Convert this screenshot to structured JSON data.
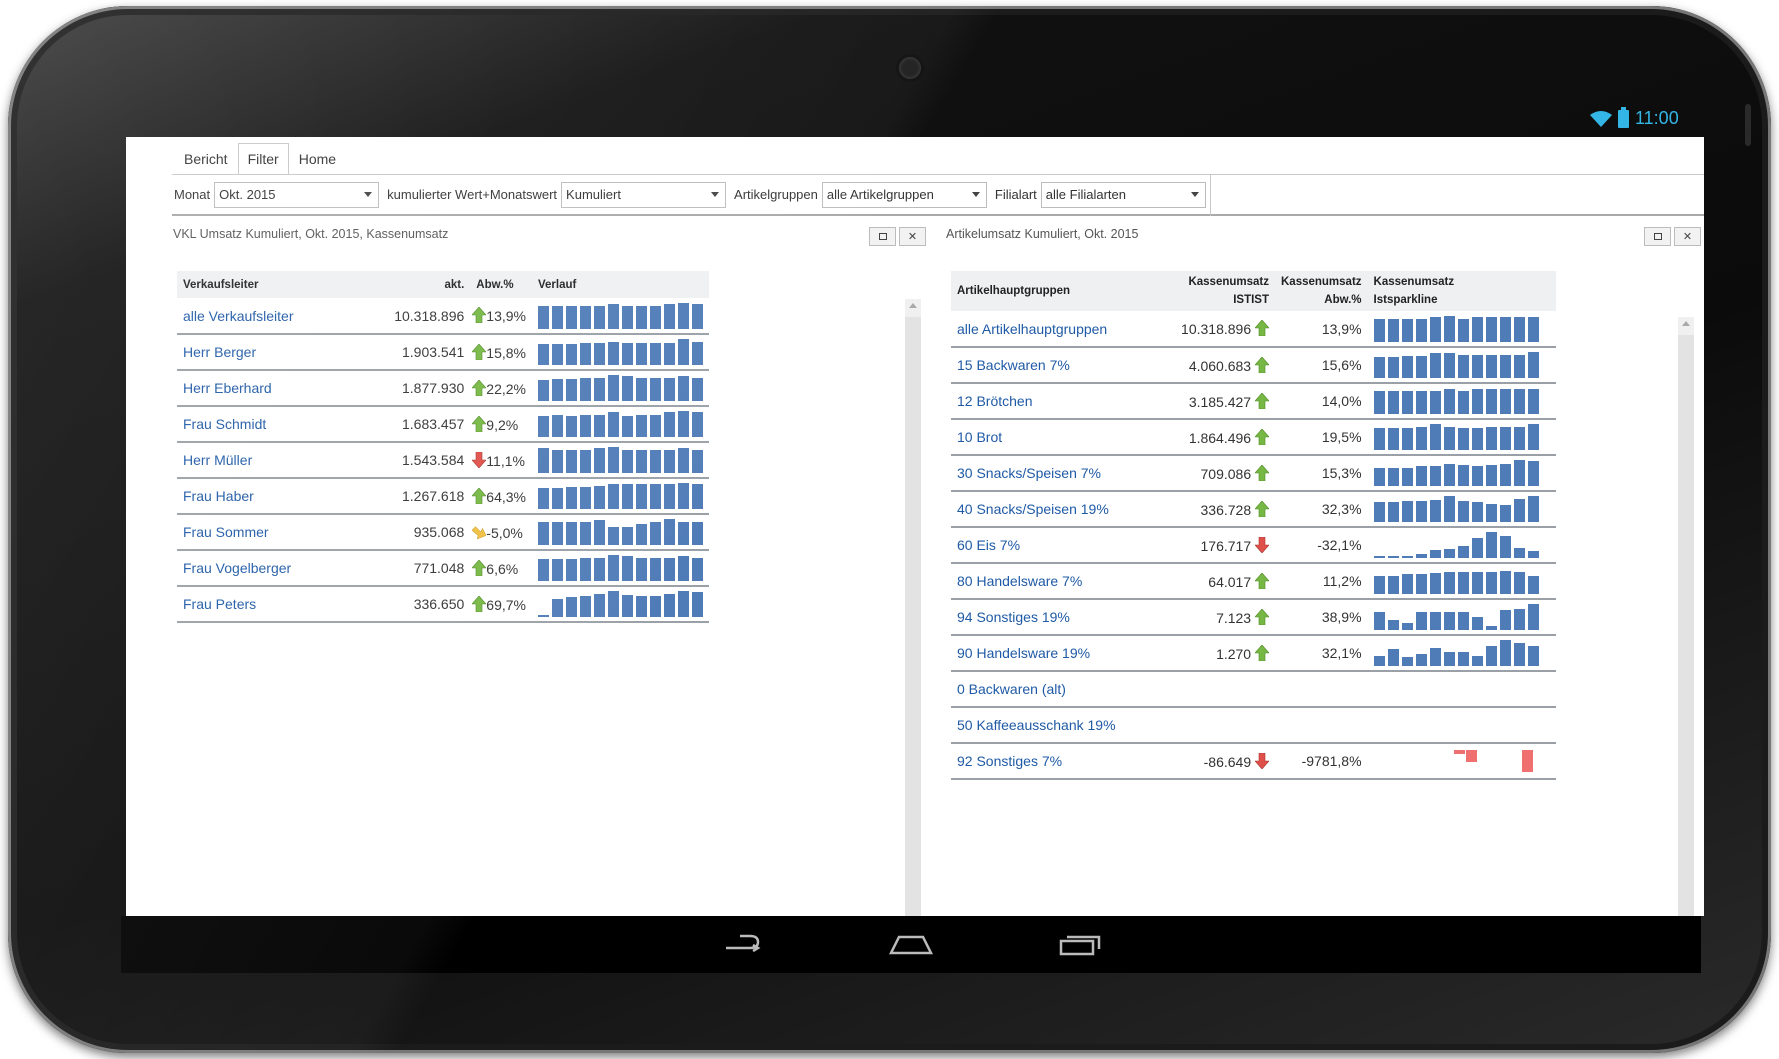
{
  "status": {
    "time": "11:00"
  },
  "tabs": [
    {
      "label": "Bericht"
    },
    {
      "label": "Filter"
    },
    {
      "label": "Home"
    }
  ],
  "filters": {
    "monat_label": "Monat",
    "monat_value": "Okt. 2015",
    "wert_label": "kumulierter Wert+Monatswert",
    "wert_value": "Kumuliert",
    "artikel_label": "Artikelgruppen",
    "artikel_value": "alle Artikelgruppen",
    "filialart_label": "Filialart",
    "filialart_value": "alle Filialarten"
  },
  "left_panel": {
    "title": "VKL Umsatz Kumuliert, Okt. 2015, Kassenumsatz",
    "headers": {
      "name": "Verkaufsleiter",
      "akt": "akt.",
      "abw": "Abw.%",
      "verlauf": "Verlauf"
    },
    "rows": [
      {
        "name": "alle Verkaufsleiter",
        "akt": "10.318.896",
        "trend": "up",
        "abw": "13,9%",
        "spark": [
          0.9,
          0.9,
          0.9,
          0.9,
          0.9,
          0.95,
          0.9,
          0.9,
          0.9,
          0.95,
          1,
          0.95
        ]
      },
      {
        "name": "Herr Berger",
        "akt": "1.903.541",
        "trend": "up",
        "abw": "15,8%",
        "spark": [
          0.8,
          0.8,
          0.8,
          0.85,
          0.85,
          0.9,
          0.85,
          0.85,
          0.85,
          0.85,
          1,
          0.9
        ]
      },
      {
        "name": "Herr Eberhard",
        "akt": "1.877.930",
        "trend": "up",
        "abw": "22,2%",
        "spark": [
          0.8,
          0.85,
          0.85,
          0.9,
          0.9,
          1,
          0.95,
          0.9,
          0.9,
          0.9,
          0.95,
          0.9
        ]
      },
      {
        "name": "Frau Schmidt",
        "akt": "1.683.457",
        "trend": "up",
        "abw": "9,2%",
        "spark": [
          0.8,
          0.85,
          0.8,
          0.85,
          0.85,
          0.95,
          0.8,
          0.85,
          0.85,
          0.95,
          1,
          0.95
        ]
      },
      {
        "name": "Herr Müller",
        "akt": "1.543.584",
        "trend": "down",
        "abw": "11,1%",
        "spark": [
          0.95,
          0.9,
          0.9,
          0.9,
          0.95,
          1,
          0.9,
          0.9,
          0.9,
          0.9,
          0.95,
          0.9
        ]
      },
      {
        "name": "Frau Haber",
        "akt": "1.267.618",
        "trend": "up",
        "abw": "64,3%",
        "spark": [
          0.8,
          0.8,
          0.85,
          0.85,
          0.9,
          0.95,
          0.95,
          0.95,
          0.95,
          0.95,
          1,
          0.95
        ]
      },
      {
        "name": "Frau Sommer",
        "akt": "935.068",
        "trend": "side",
        "abw": "-5,0%",
        "spark": [
          0.9,
          0.9,
          0.9,
          0.9,
          0.95,
          0.7,
          0.7,
          0.8,
          0.9,
          1,
          0.9,
          0.9
        ]
      },
      {
        "name": "Frau Vogelberger",
        "akt": "771.048",
        "trend": "up",
        "abw": "6,6%",
        "spark": [
          0.85,
          0.85,
          0.85,
          0.9,
          0.9,
          1,
          0.95,
          0.9,
          0.9,
          0.9,
          0.95,
          0.9
        ]
      },
      {
        "name": "Frau Peters",
        "akt": "336.650",
        "trend": "up",
        "abw": "69,7%",
        "spark": [
          0.08,
          0.7,
          0.75,
          0.8,
          0.9,
          1,
          0.85,
          0.8,
          0.8,
          0.9,
          1,
          0.95
        ]
      }
    ]
  },
  "right_panel": {
    "title": "Artikelumsatz Kumuliert, Okt. 2015",
    "headers": {
      "name": "Artikelhauptgruppen",
      "ist_top": "Kassenumsatz",
      "ist_bottom": "ISTIST",
      "abw_top": "Kassenumsatz",
      "abw_bottom": "Abw.%",
      "spark_top": "Kassenumsatz",
      "spark_bottom": "Istsparkline"
    },
    "rows": [
      {
        "name": "alle Artikelhauptgruppen",
        "ist": "10.318.896",
        "trend": "up",
        "abw": "13,9%",
        "spark": [
          0.9,
          0.9,
          0.9,
          0.9,
          0.95,
          1,
          0.9,
          0.95,
          0.95,
          0.95,
          0.95,
          0.95
        ]
      },
      {
        "name": "15 Backwaren 7%",
        "ist": "4.060.683",
        "trend": "up",
        "abw": "15,6%",
        "spark": [
          0.8,
          0.8,
          0.85,
          0.85,
          0.95,
          0.95,
          0.9,
          0.9,
          0.9,
          0.9,
          0.9,
          1
        ]
      },
      {
        "name": "12 Brötchen",
        "ist": "3.185.427",
        "trend": "up",
        "abw": "14,0%",
        "spark": [
          0.9,
          0.9,
          0.9,
          0.9,
          0.9,
          0.95,
          0.9,
          0.95,
          0.95,
          0.95,
          0.95,
          0.95
        ]
      },
      {
        "name": "10 Brot",
        "ist": "1.864.496",
        "trend": "up",
        "abw": "19,5%",
        "spark": [
          0.85,
          0.85,
          0.85,
          0.9,
          1,
          0.9,
          0.85,
          0.85,
          0.9,
          0.9,
          0.9,
          1
        ]
      },
      {
        "name": "30 Snacks/Speisen 7%",
        "ist": "709.086",
        "trend": "up",
        "abw": "15,3%",
        "spark": [
          0.7,
          0.7,
          0.7,
          0.75,
          0.75,
          0.85,
          0.8,
          0.75,
          0.8,
          0.85,
          1,
          0.95
        ]
      },
      {
        "name": "40 Snacks/Speisen 19%",
        "ist": "336.728",
        "trend": "up",
        "abw": "32,3%",
        "spark": [
          0.75,
          0.75,
          0.8,
          0.8,
          0.85,
          1,
          0.8,
          0.75,
          0.7,
          0.65,
          0.9,
          1
        ]
      },
      {
        "name": "60 Eis 7%",
        "ist": "176.717",
        "trend": "down",
        "abw": "-32,1%",
        "spark": [
          0.08,
          0.08,
          0.08,
          0.15,
          0.3,
          0.35,
          0.45,
          0.75,
          1,
          0.85,
          0.4,
          0.25
        ]
      },
      {
        "name": "80 Handelsware 7%",
        "ist": "64.017",
        "trend": "up",
        "abw": "11,2%",
        "spark": [
          0.7,
          0.7,
          0.75,
          0.75,
          0.8,
          0.85,
          0.85,
          0.85,
          0.85,
          0.9,
          0.85,
          0.7
        ]
      },
      {
        "name": "94 Sonstiges 19%",
        "ist": "7.123",
        "trend": "up",
        "abw": "38,9%",
        "spark": [
          0.7,
          0.4,
          0.25,
          0.7,
          0.7,
          0.7,
          0.7,
          0.5,
          0.15,
          0.75,
          0.8,
          1
        ]
      },
      {
        "name": "90 Handelsware 19%",
        "ist": "1.270",
        "trend": "up",
        "abw": "32,1%",
        "spark": [
          0.4,
          0.65,
          0.35,
          0.45,
          0.7,
          0.55,
          0.55,
          0.4,
          0.75,
          1,
          0.9,
          0.75
        ]
      },
      {
        "name": "0 Backwaren (alt)",
        "ist": "",
        "trend": "",
        "abw": "",
        "spark": []
      },
      {
        "name": "50 Kaffeeausschank 19%",
        "ist": "",
        "trend": "",
        "abw": "",
        "spark": []
      },
      {
        "name": "92 Sonstiges 7%",
        "ist": "-86.649",
        "trend": "down",
        "abw": "-9781,8%",
        "spark": "neg"
      }
    ]
  }
}
